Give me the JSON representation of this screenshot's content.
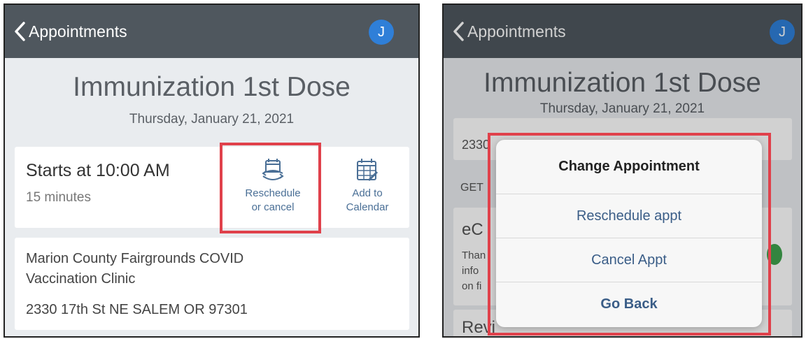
{
  "left": {
    "nav": {
      "back_label": "Appointments",
      "avatar_initial": "J"
    },
    "title": "Immunization 1st Dose",
    "date": "Thursday, January 21, 2021",
    "time_card": {
      "starts": "Starts at 10:00 AM",
      "duration": "15 minutes",
      "reschedule_line1": "Reschedule",
      "reschedule_line2": "or cancel",
      "calendar_line1": "Add to",
      "calendar_line2": "Calendar"
    },
    "location": {
      "name_line1": "Marion County Fairgrounds COVID",
      "name_line2": "Vaccination Clinic",
      "address": "2330 17th St NE SALEM OR 97301"
    }
  },
  "right": {
    "nav": {
      "back_label": "Appointments",
      "avatar_initial": "J"
    },
    "title": "Immunization 1st Dose",
    "date": "Thursday, January 21, 2021",
    "background_fragments": {
      "addr": "2330",
      "section": "GET",
      "e_c": "eC",
      "thank": "Than",
      "info": "info",
      "onfile": "on fi",
      "revi": "Revi"
    },
    "dialog": {
      "title": "Change Appointment",
      "reschedule": "Reschedule appt",
      "cancel": "Cancel Appt",
      "go_back": "Go Back"
    }
  },
  "colors": {
    "navbar": "#4f575e",
    "accent": "#2f7fd8",
    "highlight": "#e0414b",
    "link": "#4a6f96"
  }
}
